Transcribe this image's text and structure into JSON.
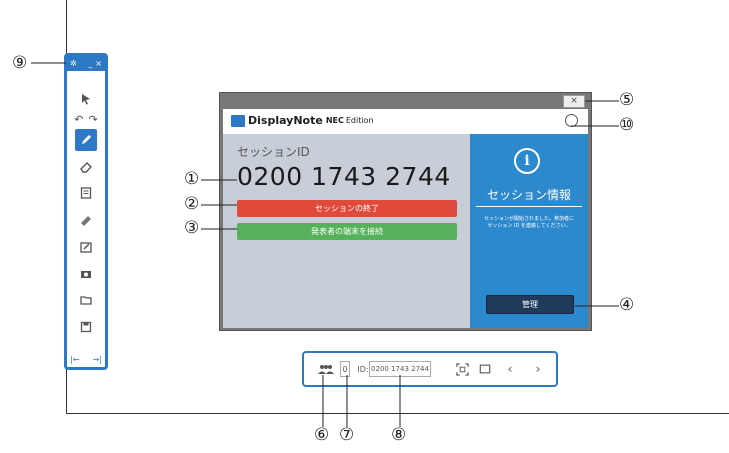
{
  "window": {
    "close_label": "×",
    "brand": "DisplayNote",
    "brand_nec": "NEC",
    "brand_edition": "Edition",
    "session_label": "セッションID",
    "session_id": "0200 1743 2744",
    "end_button": "セッションの終了",
    "connect_button": "発表者の端末を接続",
    "info_title": "セッション情報",
    "info_text_1": "セッションが開始されました。参加者に",
    "info_text_2": "セッション ID を連絡してください。",
    "manage_button": "管理"
  },
  "bottom_bar": {
    "participant_count": "0",
    "id_prefix": "ID:",
    "id_value": "0200 1743 2744"
  },
  "callouts": {
    "c1": "①",
    "c2": "②",
    "c3": "③",
    "c4": "④",
    "c5": "⑤",
    "c6": "⑥",
    "c7": "⑦",
    "c8": "⑧",
    "c9": "⑨",
    "c10": "⑩"
  },
  "toolbar": {
    "icons": [
      "settings-icon",
      "minimize-icon",
      "close-icon",
      "pointer-icon",
      "undo-icon",
      "redo-icon",
      "pen-icon",
      "eraser-icon",
      "note-icon",
      "highlighter-icon",
      "whiteboard-icon",
      "camera-icon",
      "folder-icon",
      "save-icon",
      "dock-left-icon",
      "dock-right-icon"
    ]
  },
  "colors": {
    "accent_blue": "#2d79c5",
    "end_red": "#e04a3a",
    "connect_green": "#55b25a",
    "manage_dark": "#1f3a5b",
    "info_pane_blue": "#2c89cd"
  }
}
